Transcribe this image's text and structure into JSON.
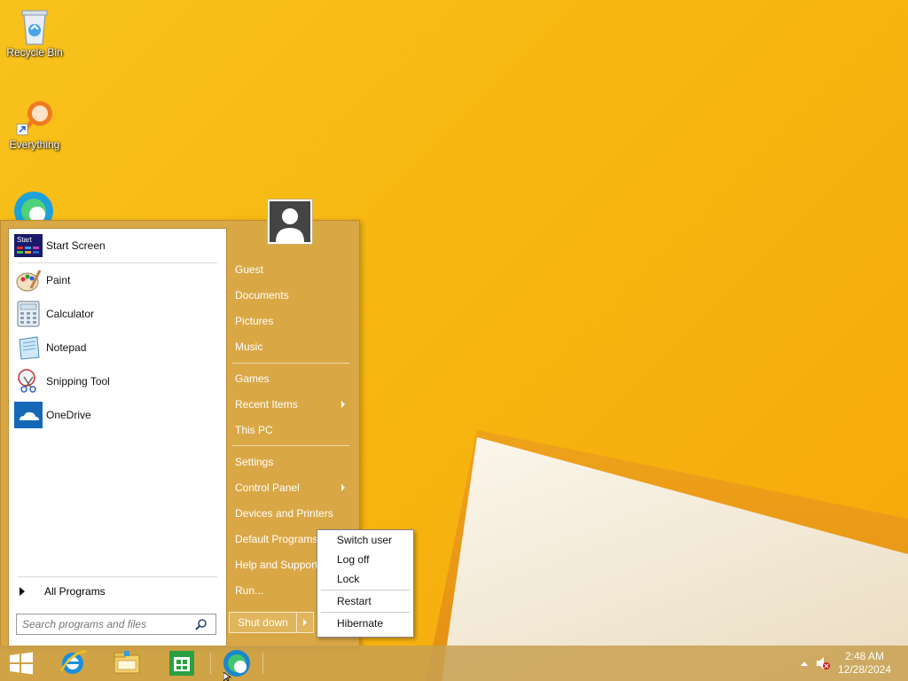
{
  "desktop": {
    "icons": [
      {
        "label": "Recycle Bin"
      },
      {
        "label": "Everything"
      }
    ]
  },
  "start_menu": {
    "left_items": [
      {
        "label": "Start Screen",
        "icon": "start-screen-icon"
      },
      {
        "label": "Paint",
        "icon": "paint-icon"
      },
      {
        "label": "Calculator",
        "icon": "calculator-icon"
      },
      {
        "label": "Notepad",
        "icon": "notepad-icon"
      },
      {
        "label": "Snipping Tool",
        "icon": "snipping-tool-icon"
      },
      {
        "label": "OneDrive",
        "icon": "onedrive-icon"
      }
    ],
    "start_tile_text": "Start",
    "all_programs": "All Programs",
    "search_placeholder": "Search programs and files",
    "right_items": [
      {
        "label": "Guest"
      },
      {
        "label": "Documents"
      },
      {
        "label": "Pictures"
      },
      {
        "label": "Music"
      },
      {
        "label": "Games"
      },
      {
        "label": "Recent Items"
      },
      {
        "label": "This PC"
      },
      {
        "label": "Settings"
      },
      {
        "label": "Control Panel"
      },
      {
        "label": "Devices and Printers"
      },
      {
        "label": "Default Programs"
      },
      {
        "label": "Help and Support"
      },
      {
        "label": "Run..."
      }
    ],
    "shutdown_label": "Shut down"
  },
  "power_popup": {
    "items": [
      "Switch user",
      "Log off",
      "Lock",
      "Restart",
      "Hibernate"
    ]
  },
  "taskbar": {
    "pinned": [
      "start-button",
      "internet-explorer-icon",
      "file-explorer-icon",
      "store-icon",
      "edge-icon"
    ],
    "clock": {
      "time": "2:48 AM",
      "date": "12/28/2024"
    }
  },
  "colors": {
    "accent": "#d6a64a",
    "wallpaper": "#f7b50f"
  }
}
